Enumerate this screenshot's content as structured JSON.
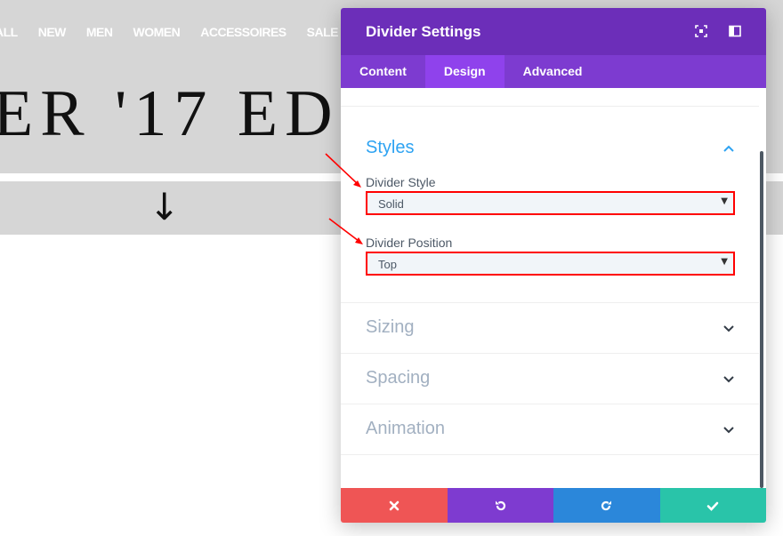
{
  "background": {
    "nav": [
      "ALL",
      "NEW",
      "MEN",
      "WOMEN",
      "ACCESSOIRES",
      "SALE"
    ],
    "headline": "ER '17 ED",
    "arrow_glyph": "↓"
  },
  "modal": {
    "title": "Divider Settings",
    "tabs": [
      {
        "label": "Content",
        "active": false
      },
      {
        "label": "Design",
        "active": true
      },
      {
        "label": "Advanced",
        "active": false
      }
    ],
    "sections": {
      "styles": {
        "title": "Styles",
        "expanded": true,
        "fields": {
          "divider_style": {
            "label": "Divider Style",
            "value": "Solid"
          },
          "divider_position": {
            "label": "Divider Position",
            "value": "Top"
          }
        }
      },
      "sizing": {
        "title": "Sizing",
        "expanded": false
      },
      "spacing": {
        "title": "Spacing",
        "expanded": false
      },
      "animation": {
        "title": "Animation",
        "expanded": false
      }
    },
    "footer_buttons": [
      {
        "action": "discard",
        "icon": "close-icon",
        "color": "#ef5555"
      },
      {
        "action": "undo",
        "icon": "undo-icon",
        "color": "#7e3bd0"
      },
      {
        "action": "redo",
        "icon": "redo-icon",
        "color": "#2b87da"
      },
      {
        "action": "save",
        "icon": "check-icon",
        "color": "#29c4a9"
      }
    ]
  },
  "colors": {
    "header": "#6c2eb9",
    "tab_bar": "#7d3bd0",
    "active_tab": "#8f42ec",
    "accent_blue": "#2ea3f2",
    "annotation_red": "#ff0000"
  }
}
